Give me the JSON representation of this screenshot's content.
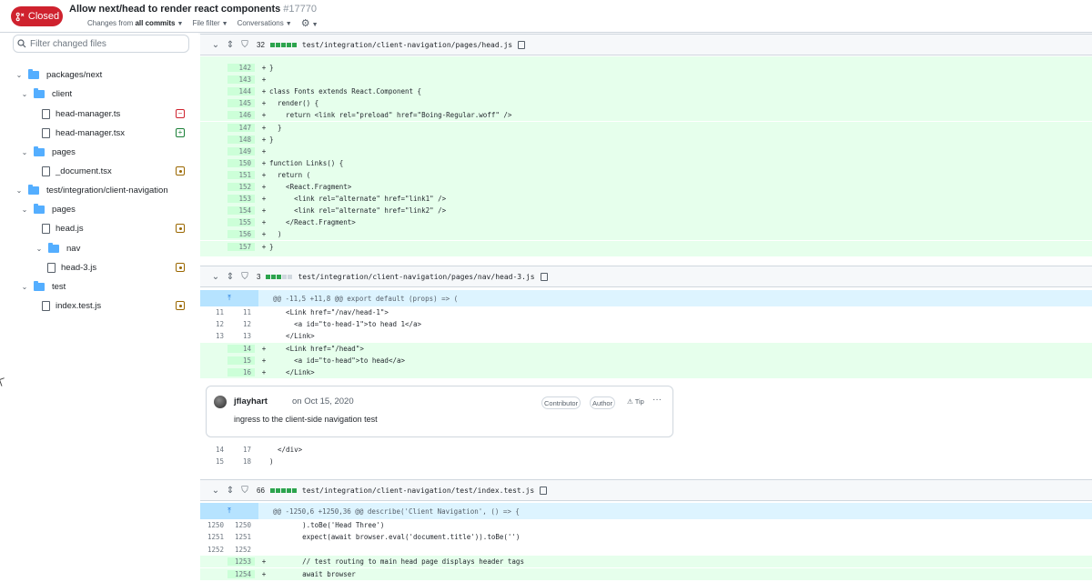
{
  "header": {
    "state_label": "Closed",
    "title": "Allow next/head to render react components",
    "number": "#17770",
    "changes_from_prefix": "Changes from",
    "changes_from_value": "all commits",
    "file_filter": "File filter",
    "conversations": "Conversations"
  },
  "sidebar": {
    "filter_placeholder": "Filter changed files",
    "tree": [
      {
        "label": "packages/next",
        "type": "folder",
        "depth": 0
      },
      {
        "label": "client",
        "type": "folder",
        "depth": 1
      },
      {
        "label": "head-manager.ts",
        "type": "file",
        "depth": 2,
        "status": "deleted"
      },
      {
        "label": "head-manager.tsx",
        "type": "file",
        "depth": 2,
        "status": "added"
      },
      {
        "label": "pages",
        "type": "folder",
        "depth": 1
      },
      {
        "label": "_document.tsx",
        "type": "file",
        "depth": 2,
        "status": "modified"
      },
      {
        "label": "test/integration/client-navigation",
        "type": "folder",
        "depth": 0
      },
      {
        "label": "pages",
        "type": "folder",
        "depth": 1
      },
      {
        "label": "head.js",
        "type": "file",
        "depth": 2,
        "status": "modified"
      },
      {
        "label": "nav",
        "type": "folder",
        "depth": 2
      },
      {
        "label": "head-3.js",
        "type": "file",
        "depth": 3,
        "status": "modified"
      },
      {
        "label": "test",
        "type": "folder",
        "depth": 1
      },
      {
        "label": "index.test.js",
        "type": "file",
        "depth": 2,
        "status": "modified"
      }
    ]
  },
  "diffs": {
    "file1": {
      "count": "32",
      "path": "test/integration/client-navigation/pages/head.js",
      "lines": [
        {
          "n": "142",
          "s": "+",
          "code": "}"
        },
        {
          "n": "143",
          "s": "+",
          "code": ""
        },
        {
          "n": "144",
          "s": "+",
          "code": "class Fonts extends React.Component {"
        },
        {
          "n": "145",
          "s": "+",
          "code": "  render() {"
        },
        {
          "n": "146",
          "s": "+",
          "code": "    return <link rel=\"preload\" href=\"Boing-Regular.woff\" />"
        },
        {
          "n": "147",
          "s": "+",
          "code": "  }"
        },
        {
          "n": "148",
          "s": "+",
          "code": "}"
        },
        {
          "n": "149",
          "s": "+",
          "code": ""
        },
        {
          "n": "150",
          "s": "+",
          "code": "function Links() {"
        },
        {
          "n": "151",
          "s": "+",
          "code": "  return ("
        },
        {
          "n": "152",
          "s": "+",
          "code": "    <React.Fragment>"
        },
        {
          "n": "153",
          "s": "+",
          "code": "      <link rel=\"alternate\" href=\"link1\" />"
        },
        {
          "n": "154",
          "s": "+",
          "code": "      <link rel=\"alternate\" href=\"link2\" />"
        },
        {
          "n": "155",
          "s": "+",
          "code": "    </React.Fragment>"
        },
        {
          "n": "156",
          "s": "+",
          "code": "  )"
        },
        {
          "n": "157",
          "s": "+",
          "code": "}"
        }
      ]
    },
    "file2": {
      "count": "3",
      "path": "test/integration/client-navigation/pages/nav/head-3.js",
      "hunk": "@@ -11,5 +11,8 @@ export default (props) => (",
      "lines": [
        {
          "o": "11",
          "n": "11",
          "s": "",
          "code": "    <Link href=\"/nav/head-1\">",
          "t": "ctx"
        },
        {
          "o": "12",
          "n": "12",
          "s": "",
          "code": "      <a id=\"to-head-1\">to head 1</a>",
          "t": "ctx"
        },
        {
          "o": "13",
          "n": "13",
          "s": "",
          "code": "    </Link>",
          "t": "ctx"
        },
        {
          "o": "",
          "n": "14",
          "s": "+",
          "code": "    <Link href=\"/head\">",
          "t": "add"
        },
        {
          "o": "",
          "n": "15",
          "s": "+",
          "code": "      <a id=\"to-head\">to head</a>",
          "t": "add"
        },
        {
          "o": "",
          "n": "16",
          "s": "+",
          "code": "    </Link>",
          "t": "add"
        }
      ],
      "after": [
        {
          "o": "14",
          "n": "17",
          "s": "",
          "code": "  </div>"
        },
        {
          "o": "15",
          "n": "18",
          "s": "",
          "code": ")"
        }
      ]
    },
    "comment": {
      "author": "jflayhart",
      "date": "on Oct 15, 2020",
      "contributor": "Contributor",
      "role": "Author",
      "tip": "Tip",
      "body": "ingress to the client-side navigation test"
    },
    "file3": {
      "count": "66",
      "path": "test/integration/client-navigation/test/index.test.js",
      "hunk": "@@ -1250,6 +1250,36 @@ describe('Client Navigation', () => {",
      "lines": [
        {
          "o": "1250",
          "n": "1250",
          "s": "",
          "code": "        ).toBe('Head Three')",
          "t": "ctx"
        },
        {
          "o": "1251",
          "n": "1251",
          "s": "",
          "code": "        expect(await browser.eval('document.title')).toBe('')",
          "t": "ctx"
        },
        {
          "o": "1252",
          "n": "1252",
          "s": "",
          "code": "",
          "t": "ctx"
        },
        {
          "o": "",
          "n": "1253",
          "s": "+",
          "code": "        // test routing to main head page displays header tags",
          "t": "add"
        },
        {
          "o": "",
          "n": "1254",
          "s": "+",
          "code": "        await browser",
          "t": "add"
        }
      ]
    }
  }
}
